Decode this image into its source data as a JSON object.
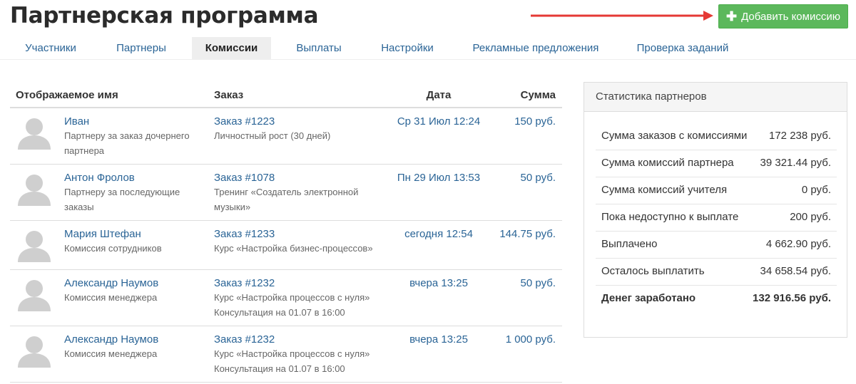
{
  "page_title": "Партнерская программа",
  "add_button": {
    "icon": "plus-icon",
    "label": "Добавить комиссию",
    "color": "#5cb85c"
  },
  "arrow_color": "#e53935",
  "tabs": [
    {
      "label": "Участники"
    },
    {
      "label": "Партнеры"
    },
    {
      "label": "Комиссии",
      "active": true
    },
    {
      "label": "Выплаты"
    },
    {
      "label": "Настройки"
    },
    {
      "label": "Рекламные предложения"
    },
    {
      "label": "Проверка заданий"
    }
  ],
  "table": {
    "headers": {
      "name": "Отображаемое имя",
      "order": "Заказ",
      "date": "Дата",
      "amount": "Сумма"
    },
    "rows": [
      {
        "avatar": "user-silhouette-icon",
        "name": "Иван",
        "description": "Партнеру за заказ дочернего партнера",
        "order": "Заказ #1223",
        "order_details": [
          "Личностный рост (30 дней)"
        ],
        "date": "Ср 31 Июл 12:24",
        "amount": "150 руб."
      },
      {
        "avatar": "user-silhouette-icon",
        "name": "Антон Фролов",
        "description": "Партнеру за последующие заказы",
        "order": "Заказ #1078",
        "order_details": [
          "Тренинг «Создатель электронной музыки»"
        ],
        "date": "Пн 29 Июл 13:53",
        "amount": "50 руб."
      },
      {
        "avatar": "user-silhouette-icon",
        "name": "Мария Штефан",
        "description": "Комиссия сотрудников",
        "order": "Заказ #1233",
        "order_details": [
          "Курс «Настройка бизнес-процессов»"
        ],
        "date": "сегодня 12:54",
        "amount": "144.75 руб."
      },
      {
        "avatar": "user-silhouette-icon",
        "name": "Александр Наумов",
        "description": "Комиссия менеджера",
        "order": "Заказ #1232",
        "order_details": [
          "Курс «Настройка процессов с нуля»",
          "Консультация на 01.07 в 16:00"
        ],
        "date": "вчера 13:25",
        "amount": "50 руб."
      },
      {
        "avatar": "user-silhouette-icon",
        "name": "Александр Наумов",
        "description": "Комиссия менеджера",
        "order": "Заказ #1232",
        "order_details": [
          "Курс «Настройка процессов с нуля»",
          "Консультация на 01.07 в 16:00"
        ],
        "date": "вчера 13:25",
        "amount": "1 000 руб."
      }
    ]
  },
  "stats": {
    "title": "Статистика партнеров",
    "rows": [
      {
        "label": "Сумма заказов с комиссиями",
        "value": "172 238 руб."
      },
      {
        "label": "Сумма комиссий партнера",
        "value": "39 321.44 руб."
      },
      {
        "label": "Сумма комиссий учителя",
        "value": "0 руб."
      },
      {
        "label": "Пока недоступно к выплате",
        "value": "200 руб."
      },
      {
        "label": "Выплачено",
        "value": "4 662.90 руб."
      },
      {
        "label": "Осталось выплатить",
        "value": "34 658.54 руб."
      },
      {
        "label": "Денег заработано",
        "value": "132 916.56 руб.",
        "bold": true
      }
    ]
  }
}
